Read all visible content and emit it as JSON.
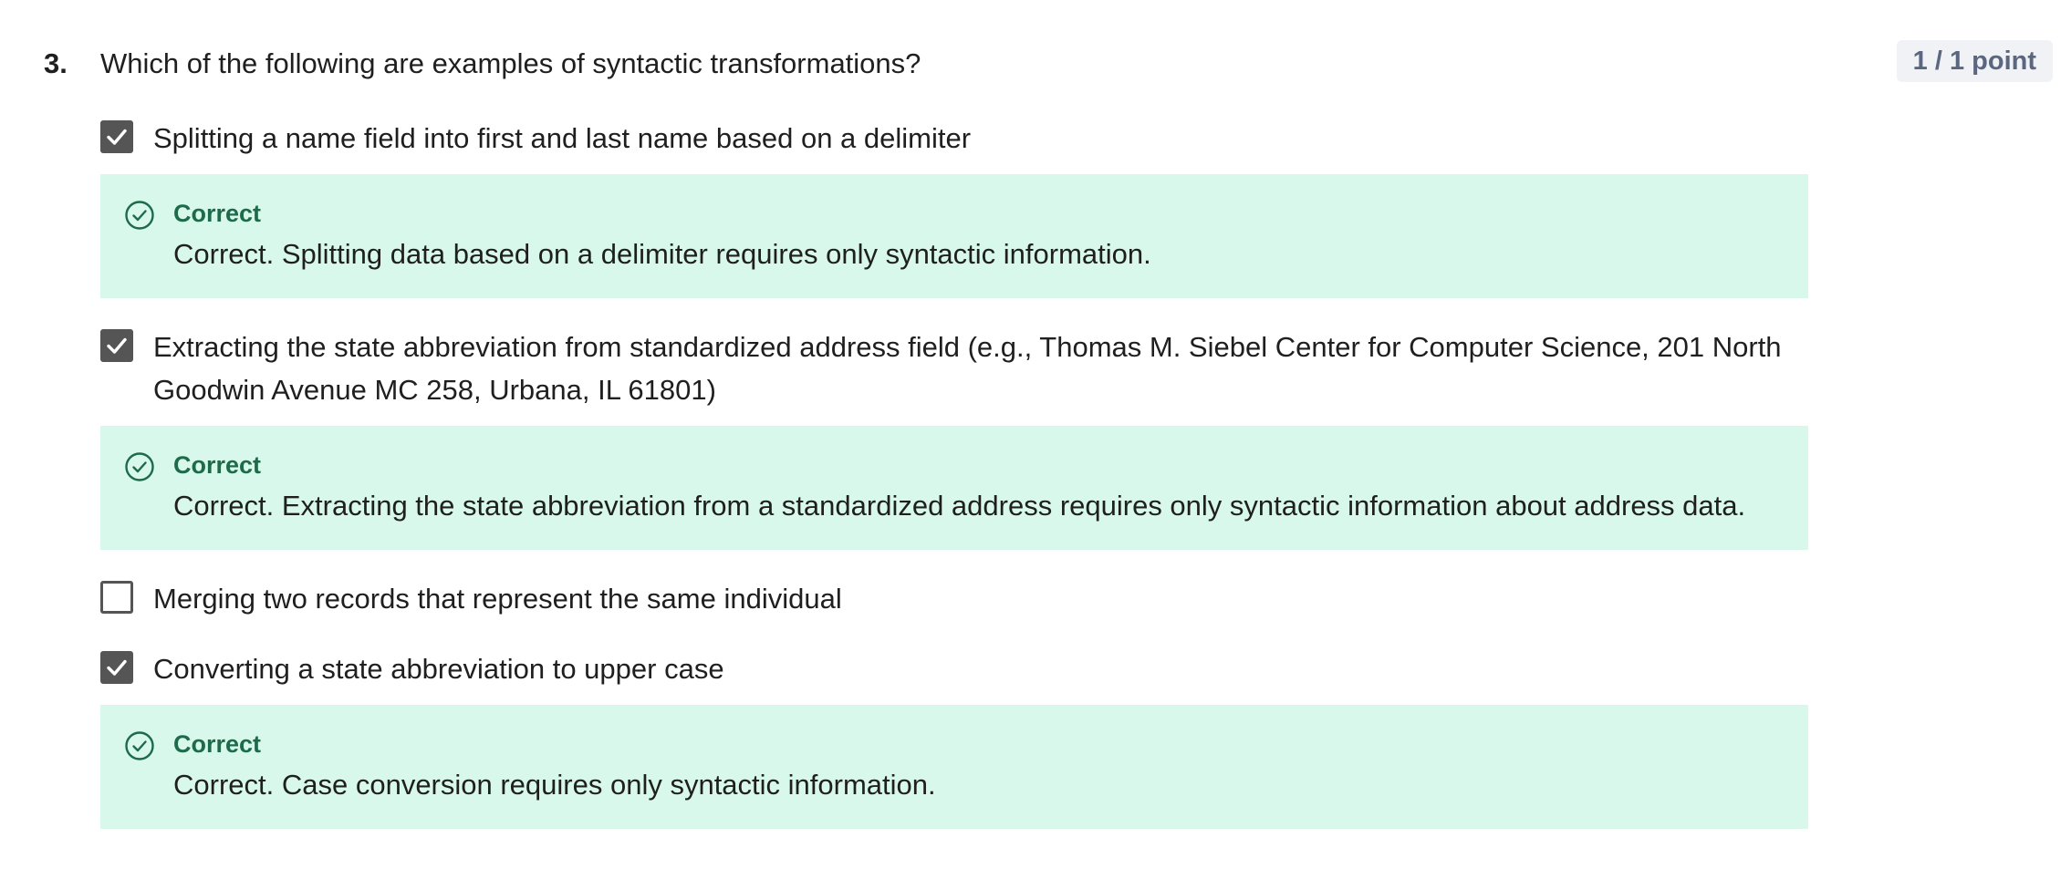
{
  "question": {
    "number": "3.",
    "text": "Which of the following are examples of syntactic transformations?",
    "points": "1 / 1 point"
  },
  "options": [
    {
      "label": "Splitting a name field into first and last name based on a delimiter",
      "checked": true,
      "feedback": {
        "title": "Correct",
        "text": "Correct. Splitting data based on a delimiter requires only syntactic information."
      }
    },
    {
      "label_line1": "Extracting the state abbreviation from standardized address field (e.g., Thomas M. Siebel Center for Computer Science, 201 North",
      "label_line2": "Goodwin Avenue MC 258, Urbana, IL 61801)",
      "checked": true,
      "feedback": {
        "title": "Correct",
        "text": "Correct. Extracting the state abbreviation from a standardized address requires only syntactic information about address data."
      }
    },
    {
      "label": "Merging two records that represent the same individual",
      "checked": false
    },
    {
      "label": "Converting a state abbreviation to upper case",
      "checked": true,
      "feedback": {
        "title": "Correct",
        "text": "Correct. Case conversion requires only syntactic information."
      }
    }
  ],
  "icons": {
    "checkbox_checked": "checkmark-icon",
    "feedback_correct": "check-circle-icon"
  },
  "colors": {
    "feedback_bg": "#d8f8ec",
    "feedback_title": "#1d6b4a",
    "checkbox": "#555555",
    "badge_bg": "#f0f2f5",
    "badge_text": "#5b6780"
  }
}
